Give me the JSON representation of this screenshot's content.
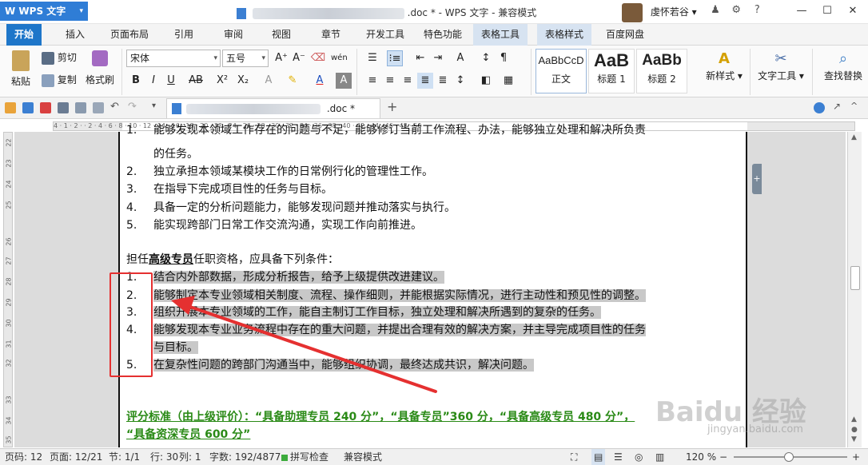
{
  "titlebar": {
    "app_name": "WPS 文字",
    "doc_title": ".doc * - WPS 文字 - 兼容模式",
    "user_name": "虔怀若谷"
  },
  "menu": {
    "tabs": [
      "开始",
      "插入",
      "页面布局",
      "引用",
      "审阅",
      "视图",
      "章节",
      "开发工具",
      "特色功能",
      "表格工具",
      "表格样式",
      "百度网盘"
    ],
    "active": "开始"
  },
  "ribbon": {
    "paste": "粘贴",
    "cut": "剪切",
    "copy": "复制",
    "format_painter": "格式刷",
    "font_name": "宋体",
    "font_size": "五号",
    "styles": [
      {
        "sample": "AaBbCcD",
        "name": "正文"
      },
      {
        "sample": "AaB",
        "name": "标题 1"
      },
      {
        "sample": "AaBb",
        "name": "标题 2"
      }
    ],
    "new_style": "新样式",
    "text_tools": "文字工具",
    "find_replace": "查找替换"
  },
  "doctab": {
    "name": ".doc *"
  },
  "ruler": {
    "h_ticks": "4 · 1 · 2 · · 2 · 4 · 6 · 8 · 10 · 12 · 14 · 16 · 18 · 20 · 22 · 24 · 26 · 28 · 30 · 32 · 34 · 36 · 38 · 40 · 42 · 44 · 46 · 48 · 50",
    "v_ticks": [
      "22",
      "23",
      "24",
      "25",
      "26",
      "27",
      "28",
      "29",
      "30",
      "31",
      "32",
      "33",
      "34",
      "35"
    ]
  },
  "document": {
    "top_clipped": "能够发现本领域工作存在的问题与不足，能够修订当前工作流程、办法，能够独立处理和解决所负责",
    "top_items": [
      {
        "num": "",
        "text": "的任务。"
      },
      {
        "num": "2.",
        "text": "独立承担本领域某模块工作的日常例行化的管理性工作。"
      },
      {
        "num": "3.",
        "text": "在指导下完成项目性的任务与目标。"
      },
      {
        "num": "4.",
        "text": "具备一定的分析问题能力，能够发现问题并推动落实与执行。"
      },
      {
        "num": "5.",
        "text": "能实现跨部门日常工作交流沟通，实现工作向前推进。"
      }
    ],
    "intro_prefix": "担任",
    "intro_bold": "高级专员",
    "intro_suffix": "任职资格，应具备下列条件：",
    "items": [
      {
        "num": "1.",
        "text": "结合内外部数据，形成分析报告，给予上级提供改进建议。"
      },
      {
        "num": "2.",
        "text": "能够制定本专业领域相关制度、流程、操作细则，并能根据实际情况，进行主动性和预见性的调整。"
      },
      {
        "num": "3.",
        "text": "组织开展本专业领域的工作，能自主制订工作目标，独立处理和解决所遇到的复杂的任务。"
      },
      {
        "num": "4.",
        "text": "能够发现本专业业务流程中存在的重大问题，并提出合理有效的解决方案，并主导完成项目性的任务"
      },
      {
        "num": "",
        "text": "与目标。"
      },
      {
        "num": "5.",
        "text": "在复杂性问题的跨部门沟通当中，能够组织协调，最终达成共识，解决问题。"
      }
    ],
    "score_line1": "评分标准（由上级评价）：“具备助理专员 240 分”，“具备专员”360 分，“具备高级专员 480 分”，",
    "score_line2": "“具备资深专员 600 分”"
  },
  "statusbar": {
    "page_num": "页码: 12",
    "page_of": "页面: 12/21",
    "section": "节: 1/1",
    "row": "行: 30",
    "col": "列: 1",
    "word_count": "字数: 192/4877",
    "spellcheck": "拼写检查",
    "compat": "兼容模式",
    "zoom": "120 %"
  },
  "watermark": {
    "main": "Baidu 经验",
    "sub": "jingyan.baidu.com"
  },
  "colors": {
    "accent": "#1e76c9",
    "highlight": "#c8c8c8",
    "annotation": "#e53030",
    "score_text": "#2a8a16"
  }
}
